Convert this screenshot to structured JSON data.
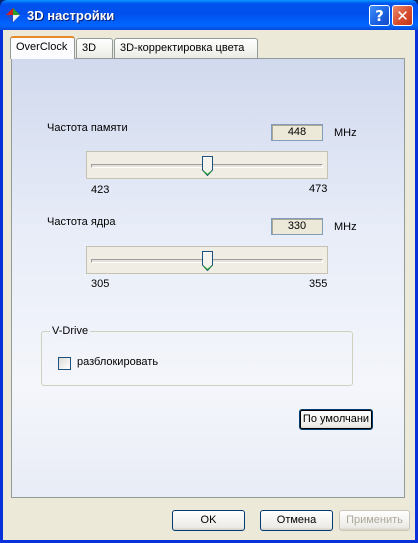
{
  "window": {
    "title": "3D настройки",
    "help_glyph": "?",
    "close_glyph": "✕"
  },
  "tabs": [
    {
      "label": "OverClock",
      "active": true
    },
    {
      "label": "3D",
      "active": false
    },
    {
      "label": "3D-корректировка цвета",
      "active": false
    }
  ],
  "memory": {
    "label": "Частота памяти",
    "value": "448",
    "unit": "MHz",
    "min": "423",
    "max": "473",
    "level": 0.5
  },
  "core": {
    "label": "Частота ядра",
    "value": "330",
    "unit": "MHz",
    "min": "305",
    "max": "355",
    "level": 0.5
  },
  "vdrive": {
    "legend": "V-Drive",
    "checkbox_label": "разблокировать",
    "checked": false
  },
  "buttons": {
    "default": "По умолчани",
    "ok": "OK",
    "cancel": "Отмена",
    "apply": "Применить"
  },
  "colors": {
    "titlebar": "#0054e3",
    "tab_highlight": "#e68b2c",
    "panel_top": "#d1d9ee"
  }
}
